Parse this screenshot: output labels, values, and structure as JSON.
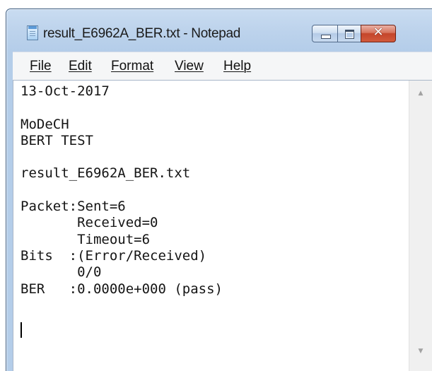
{
  "window": {
    "title": "result_E6962A_BER.txt - Notepad"
  },
  "menu": {
    "items": [
      {
        "label": "File"
      },
      {
        "label": "Edit"
      },
      {
        "label": "Format"
      },
      {
        "label": "View"
      },
      {
        "label": "Help"
      }
    ]
  },
  "editor": {
    "content": "13-Oct-2017\n\nMoDeCH\nBERT TEST\n\nresult_E6962A_BER.txt\n\nPacket:Sent=6\n       Received=0\n       Timeout=6\nBits  :(Error/Received)\n       0/0\nBER   :0.0000e+000 (pass)"
  },
  "icons": {
    "app": "notepad-icon",
    "minimize": "minimize-icon",
    "maximize": "maximize-icon",
    "close": "close-icon",
    "scroll_up": "scroll-up-arrow-icon",
    "scroll_down": "scroll-down-arrow-icon"
  },
  "colors": {
    "titlebar": "#bdd3ec",
    "close_button": "#c4452b",
    "menubar": "#f5f6f7",
    "editor_background": "#ffffff"
  }
}
